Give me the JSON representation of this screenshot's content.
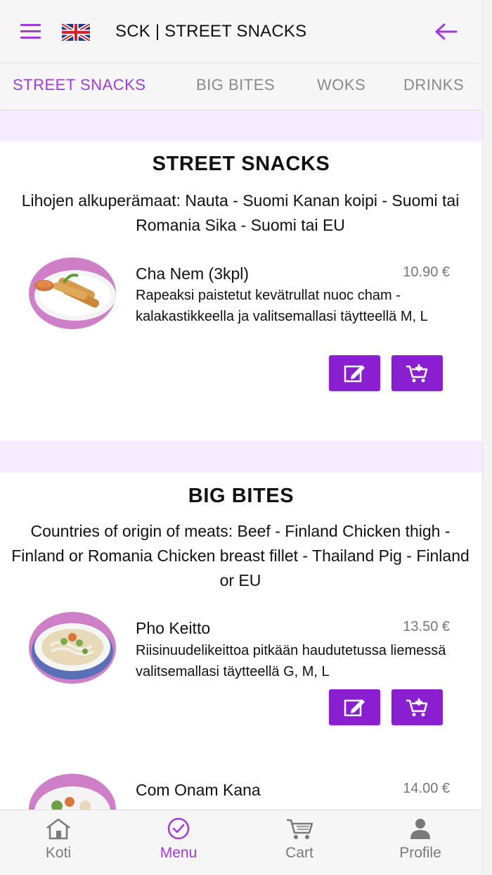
{
  "header": {
    "title": "SCK | STREET SNACKS",
    "menu_icon": "hamburger-menu-icon",
    "flag_icon": "uk-flag-icon",
    "back_icon": "arrow-left-icon"
  },
  "tabs": [
    {
      "label": "STREET SNACKS",
      "active": true
    },
    {
      "label": "BIG BITES",
      "active": false
    },
    {
      "label": "WOKS",
      "active": false
    },
    {
      "label": "DRINKS",
      "active": false
    }
  ],
  "sections": [
    {
      "title": "STREET SNACKS",
      "description": "Lihojen alkuperämaat: Nauta - Suomi Kanan koipi - Suomi tai Romania Sika - Suomi tai EU",
      "dishes": [
        {
          "name": "Cha Nem (3kpl)",
          "price": "10.90 €",
          "description": "Rapeaksi paistetut kevätrullat nuoc cham -kalakastikkeella ja valitsemallasi täytteellä M, L"
        }
      ]
    },
    {
      "title": "BIG BITES",
      "description": "Countries of origin of meats: Beef - Finland Chicken thigh - Finland or Romania Chicken breast fillet - Thailand Pig - Finland or EU",
      "dishes": [
        {
          "name": "Pho Keitto",
          "price": "13.50 €",
          "description": "Riisinuudelikeittoa pitkään haudutetussa liemessä valitsemallasi täytteellä G, M, L"
        },
        {
          "name": "Com Onam Kana",
          "price": "14.00 €",
          "description": ""
        }
      ]
    }
  ],
  "bottom_nav": [
    {
      "label": "Koti",
      "icon": "home-icon",
      "active": false
    },
    {
      "label": "Menu",
      "icon": "check-circle-icon",
      "active": true
    },
    {
      "label": "Cart",
      "icon": "cart-icon",
      "active": false
    },
    {
      "label": "Profile",
      "icon": "user-icon",
      "active": false
    }
  ],
  "colors": {
    "accent": "#a13bd9",
    "button": "#8a1ed1",
    "section_band": "#f7ecfd",
    "plate": "#cf7fc8"
  }
}
